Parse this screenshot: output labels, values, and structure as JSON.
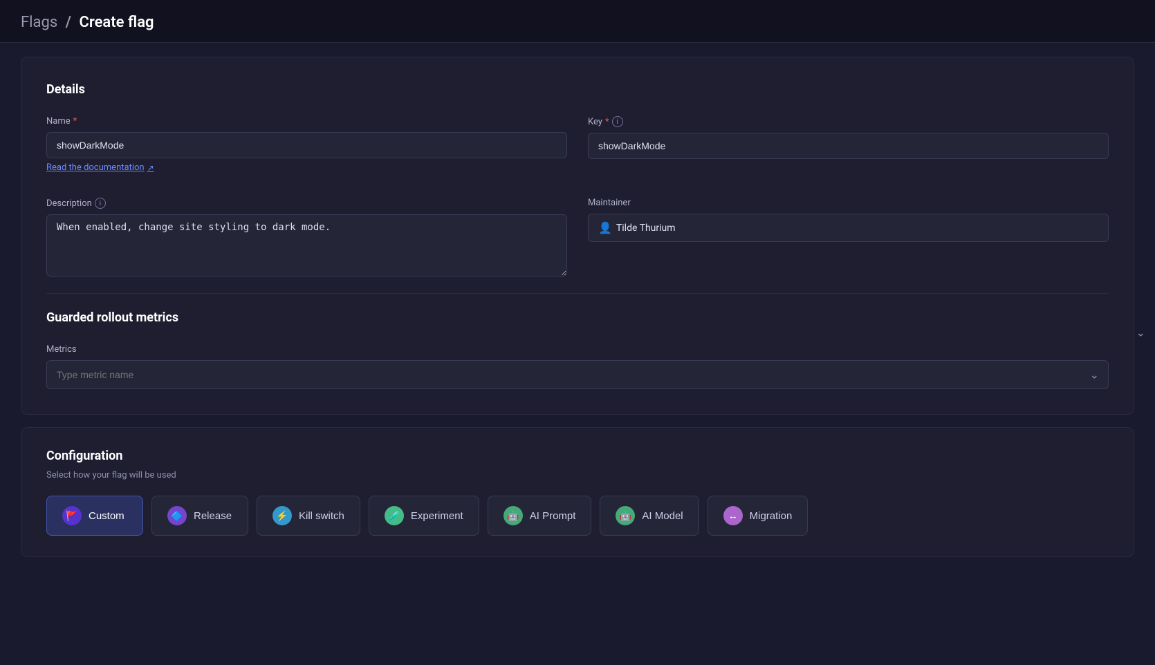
{
  "header": {
    "flags_label": "Flags",
    "separator": "/",
    "page_title": "Create flag"
  },
  "details_section": {
    "title": "Details",
    "name_label": "Name",
    "name_required": "*",
    "name_value": "showDarkMode",
    "key_label": "Key",
    "key_required": "*",
    "key_value": "showDarkMode",
    "doc_link": "Read the documentation",
    "description_label": "Description",
    "description_value": "When enabled, change site styling to dark mode.",
    "maintainer_label": "Maintainer",
    "maintainer_value": "Tilde Thurium"
  },
  "metrics_section": {
    "title": "Guarded rollout metrics",
    "metrics_label": "Metrics",
    "metrics_placeholder": "Type metric name"
  },
  "configuration_section": {
    "title": "Configuration",
    "subtitle": "Select how your flag will be used",
    "flag_types": [
      {
        "id": "custom",
        "label": "Custom",
        "icon": "🚩",
        "active": true
      },
      {
        "id": "release",
        "label": "Release",
        "icon": "🔷",
        "active": false
      },
      {
        "id": "kill-switch",
        "label": "Kill switch",
        "icon": "⚡",
        "active": false
      },
      {
        "id": "experiment",
        "label": "Experiment",
        "icon": "🧪",
        "active": false
      },
      {
        "id": "ai-prompt",
        "label": "AI Prompt",
        "icon": "🤖",
        "active": false
      },
      {
        "id": "ai-model",
        "label": "AI Model",
        "icon": "🤖",
        "active": false
      },
      {
        "id": "migration",
        "label": "Migration",
        "icon": "↔",
        "active": false
      }
    ]
  }
}
